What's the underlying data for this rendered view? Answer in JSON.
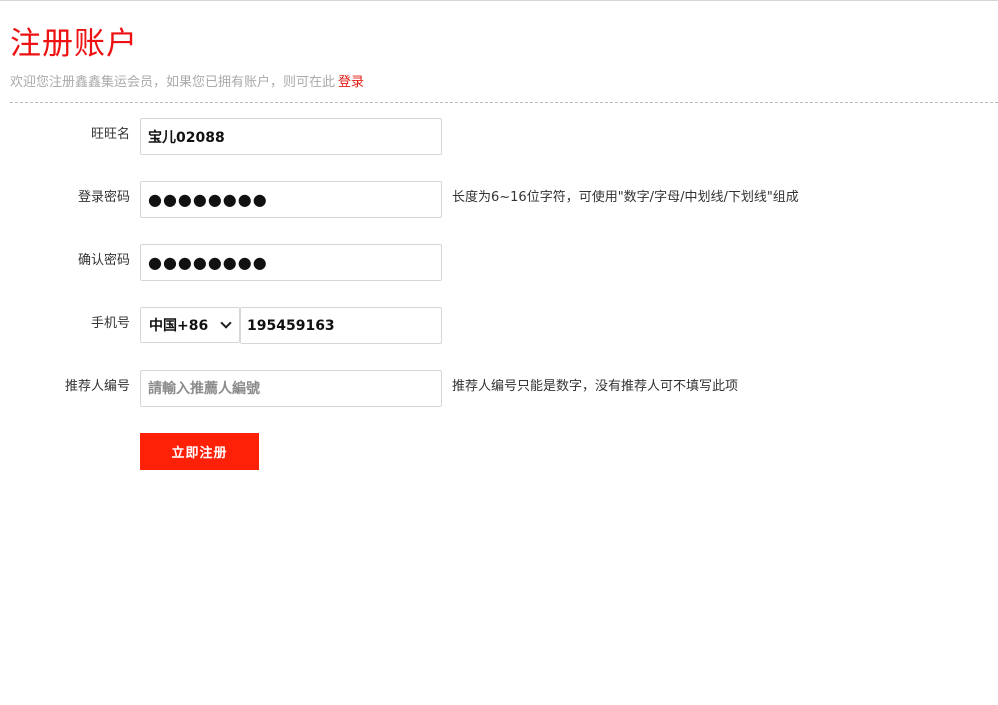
{
  "page": {
    "title": "注册账户",
    "subtitle": "欢迎您注册鑫鑫集运会员，如果您已拥有账户，则可在此",
    "login_link": "登录"
  },
  "form": {
    "username": {
      "label": "旺旺名",
      "value": "宝儿02088"
    },
    "password": {
      "label": "登录密码",
      "value": "●●●●●●●●",
      "hint": "长度为6~16位字符，可使用\"数字/字母/中划线/下划线\"组成"
    },
    "confirm_password": {
      "label": "确认密码",
      "value": "●●●●●●●●"
    },
    "phone": {
      "label": "手机号",
      "country_code": "中国+86",
      "value": "195459163"
    },
    "referrer": {
      "label": "推荐人编号",
      "placeholder": "請輸入推薦人編號",
      "hint": "推荐人编号只能是数字，没有推荐人可不填写此项"
    },
    "submit_label": "立即注册"
  },
  "colors": {
    "brand_red": "#ee1111",
    "button_red": "#ff2008",
    "muted_text": "#aaaaaa"
  }
}
